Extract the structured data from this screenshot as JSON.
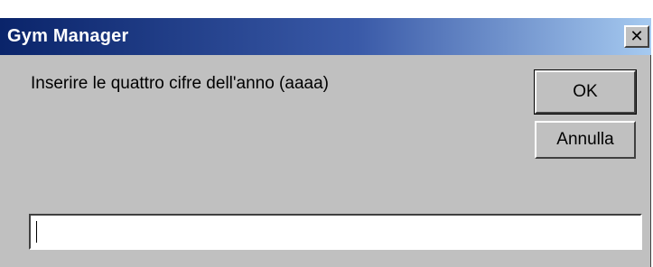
{
  "window": {
    "title": "Gym Manager",
    "close_glyph": "✕"
  },
  "dialog": {
    "prompt": "Inserire le quattro cifre dell'anno (aaaa)",
    "ok_label": "OK",
    "cancel_label": "Annulla",
    "input_value": ""
  },
  "colors": {
    "titlebar_start": "#0a246a",
    "titlebar_end": "#a6caf0",
    "face": "#c0c0c0"
  }
}
